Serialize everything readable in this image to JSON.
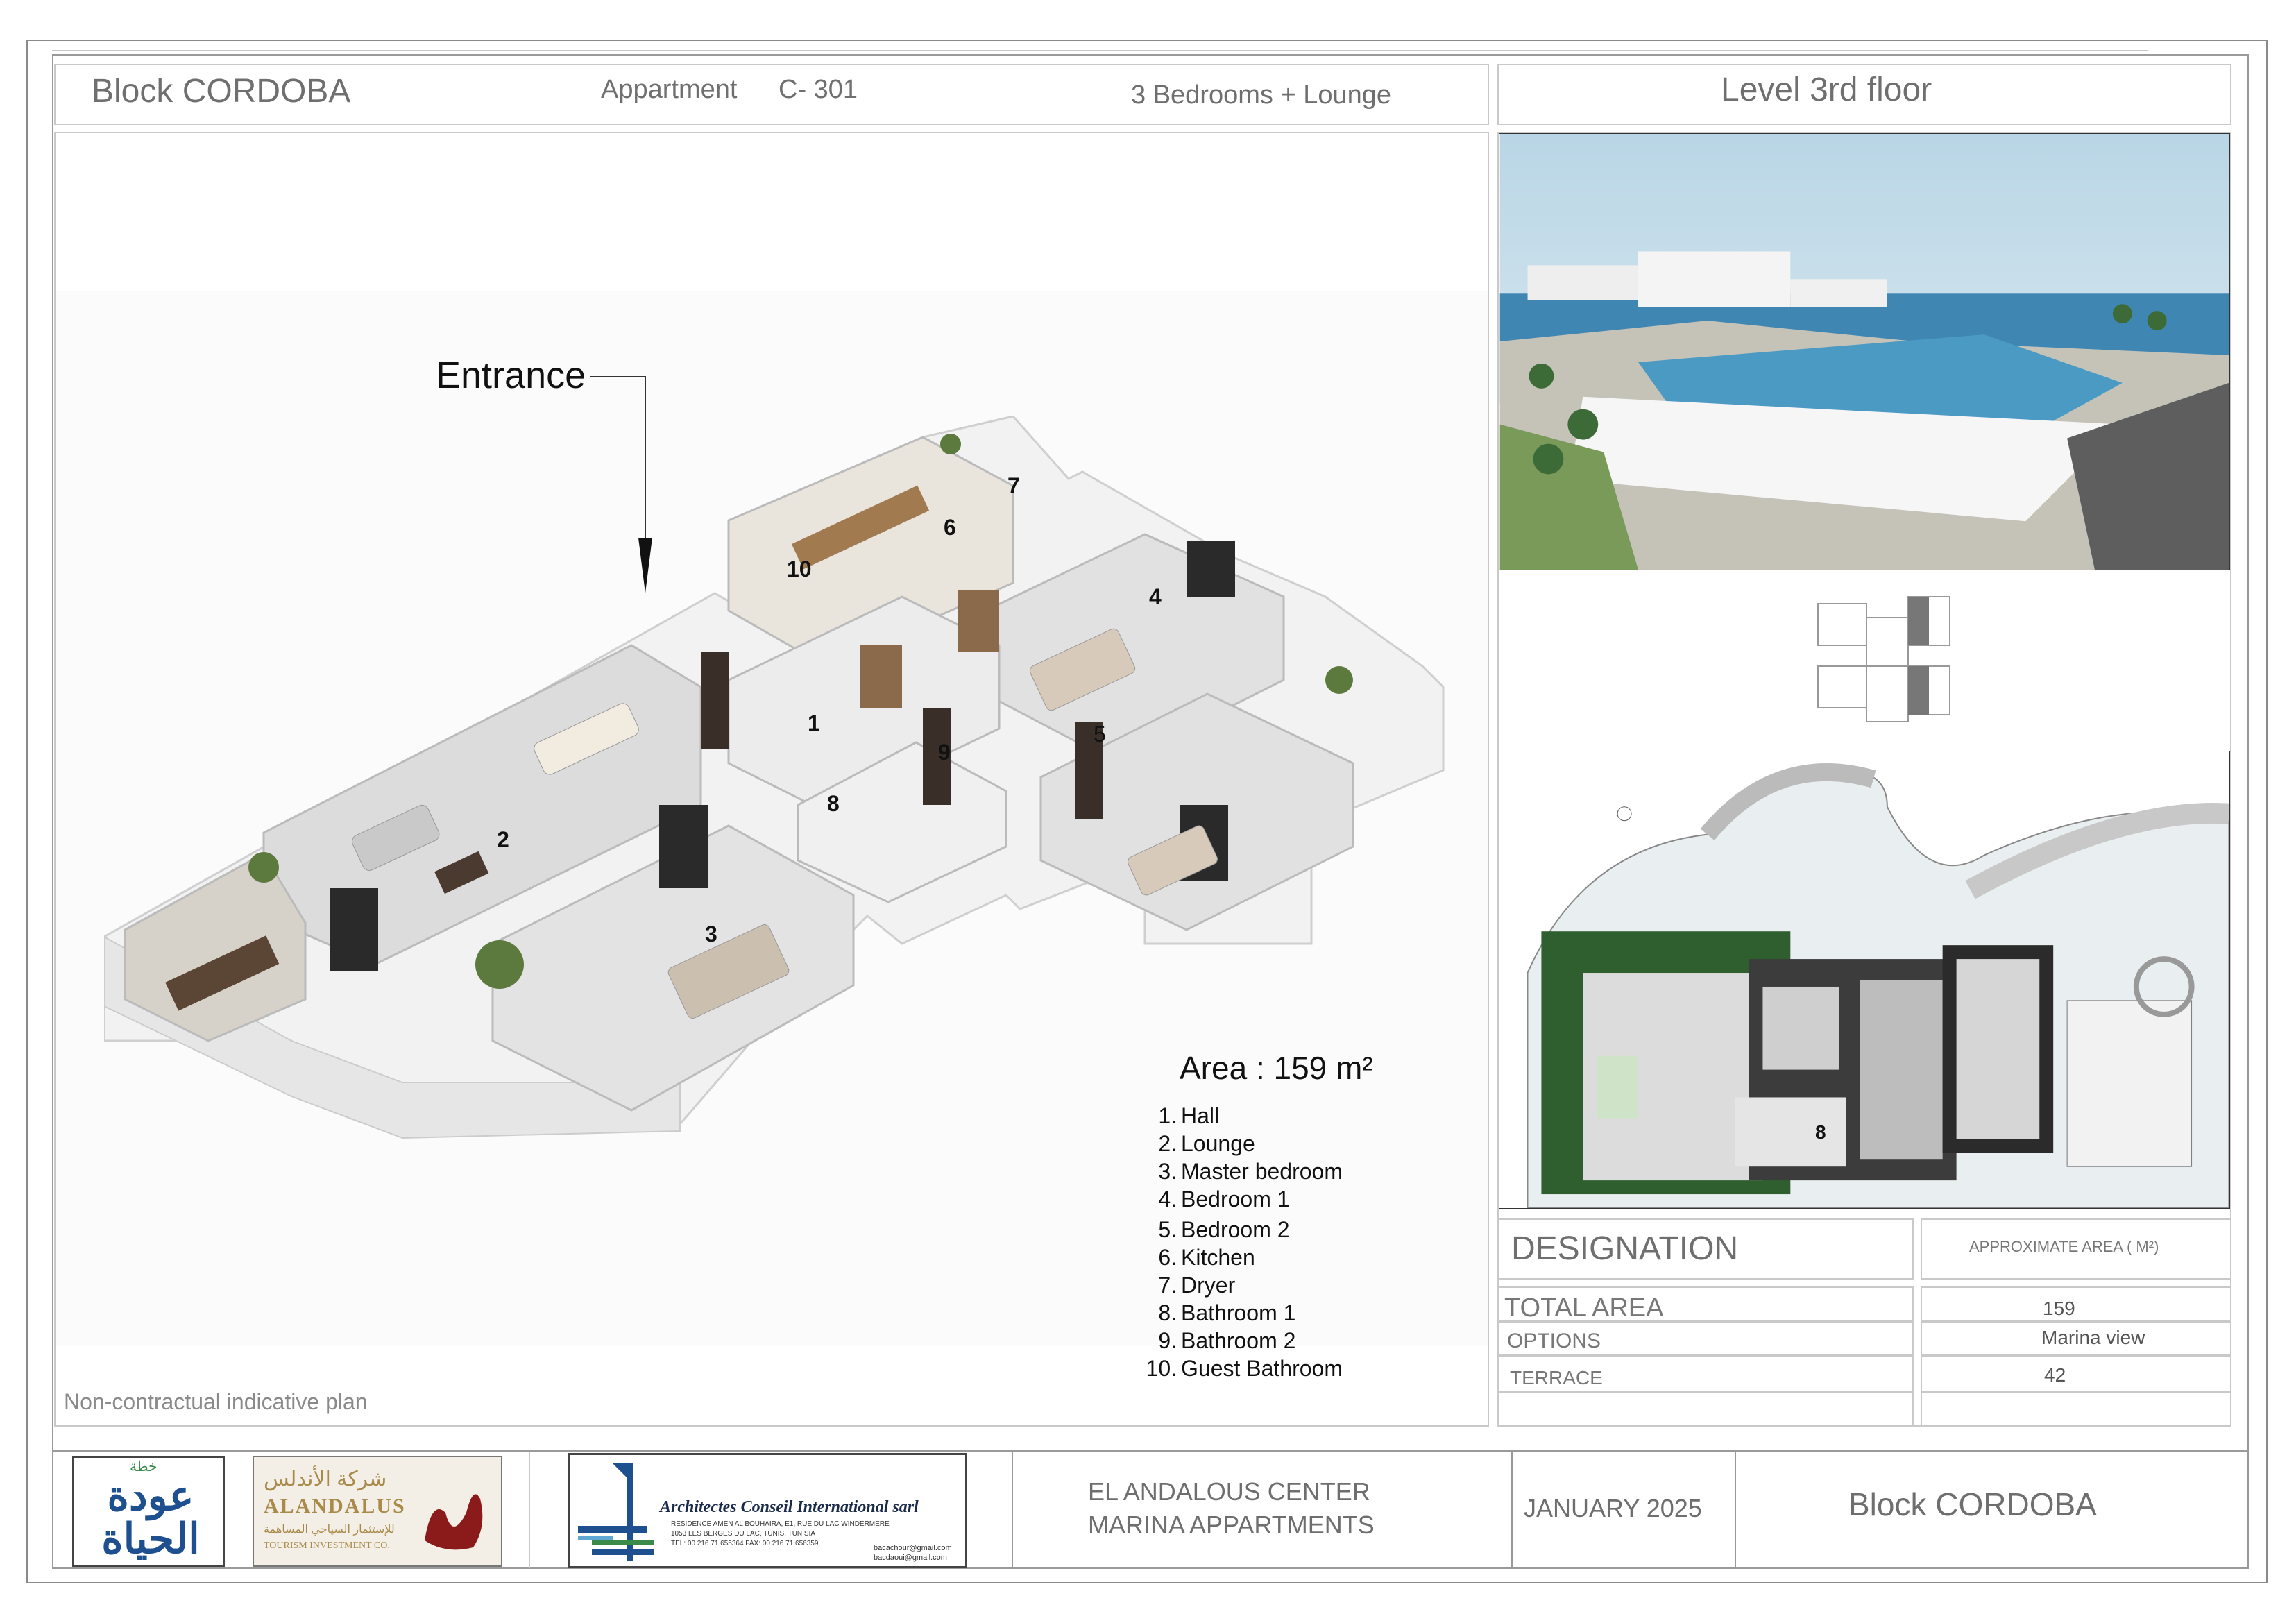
{
  "header": {
    "block": "Block CORDOBA",
    "apartment_label": "Appartment",
    "apartment_id": "C- 301",
    "rooms": "3  Bedrooms + Lounge",
    "level": "Level 3rd  floor"
  },
  "plan": {
    "entrance": "Entrance",
    "area": "Area : 159 m²",
    "disclaimer": "Non-contractual indicative plan",
    "room_markers": [
      "1",
      "2",
      "3",
      "4",
      "5",
      "6",
      "7",
      "8",
      "9",
      "10"
    ],
    "legend": [
      {
        "num": "1.",
        "label": "Hall"
      },
      {
        "num": "2.",
        "label": "Lounge"
      },
      {
        "num": "3.",
        "label": "Master bedroom"
      },
      {
        "num": "4.",
        "label": "Bedroom 1"
      },
      {
        "num": "5.",
        "label": "Bedroom 2"
      },
      {
        "num": "6.",
        "label": "Kitchen"
      },
      {
        "num": "7.",
        "label": "Dryer"
      },
      {
        "num": "8.",
        "label": "Bathroom 1"
      },
      {
        "num": "9.",
        "label": "Bathroom 2"
      },
      {
        "num": "10.",
        "label": "Guest Bathroom"
      }
    ]
  },
  "site_plan": {
    "marker": "8"
  },
  "table": {
    "designation": "DESIGNATION",
    "approx_area": "APPROXIMATE AREA  ( M²)",
    "rows": [
      {
        "label": "TOTAL AREA",
        "value": "159"
      },
      {
        "label": "OPTIONS",
        "value": "Marina view"
      },
      {
        "label": "TERRACE",
        "value": "42"
      }
    ]
  },
  "footer": {
    "logo1_top": "خطة",
    "logo1_main": "عودة الحياة",
    "logo2_ar": "شركة الأندلس",
    "logo2_en": "ALANDALUS",
    "logo2_sub_ar": "للإستثمار السياحي المساهمة",
    "logo2_sub_en": "TOURISM INVESTMENT CO.",
    "architect_name": "Architectes  Conseil  International sarl",
    "architect_addr1": "RESIDENCE  AMEN AL BOUHAIRA, E1, RUE DU LAC WINDERMERE",
    "architect_addr2": "1053 LES BERGES DU LAC, TUNIS, TUNISIA",
    "architect_tel": "TEL: 00 216 71 655364   FAX: 00 216 71 656359",
    "architect_mail1": "bacachour@gmail.com",
    "architect_mail2": "bacdaoui@gmail.com",
    "project_line1": "EL ANDALOUS CENTER",
    "project_line2": "MARINA APPARTMENTS",
    "date": "JANUARY  2025",
    "block": "Block  CORDOBA"
  },
  "colors": {
    "frame": "#8a8a8a",
    "logo_blue": "#1e4f8f",
    "logo_green": "#3a8a4a",
    "logo_red": "#8b1a1a",
    "logo_gold": "#a88a4a",
    "sea": "#4a8fb8",
    "sky": "#cfe4ef"
  }
}
